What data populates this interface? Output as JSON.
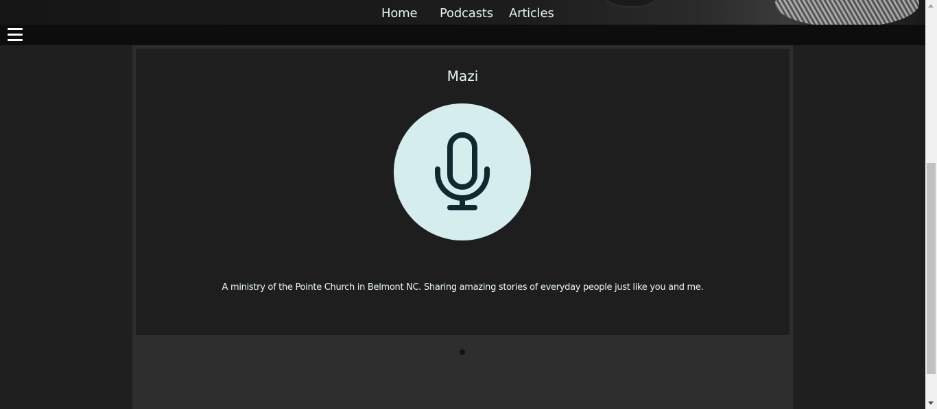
{
  "nav": {
    "links": [
      {
        "label": "Home"
      },
      {
        "label": "Podcasts"
      },
      {
        "label": "Articles"
      }
    ],
    "active": "Podcasts"
  },
  "menu": {
    "icon": "hamburger-menu-icon"
  },
  "podcast": {
    "title": "Mazi",
    "artwork_icon": "microphone-icon",
    "description": "A ministry of the Pointe Church in Belmont NC. Sharing amazing stories of everyday people just like you and me."
  },
  "carousel": {
    "dot_count": 1,
    "active_index": 0
  },
  "colors": {
    "page_bg": "#1f1f1f",
    "menubar_bg": "#0d0d0d",
    "card_bg": "#1e1e1e",
    "artwork_bg": "#d6eded",
    "icon_color": "#0e2a30",
    "text": "#e8f6f6"
  }
}
